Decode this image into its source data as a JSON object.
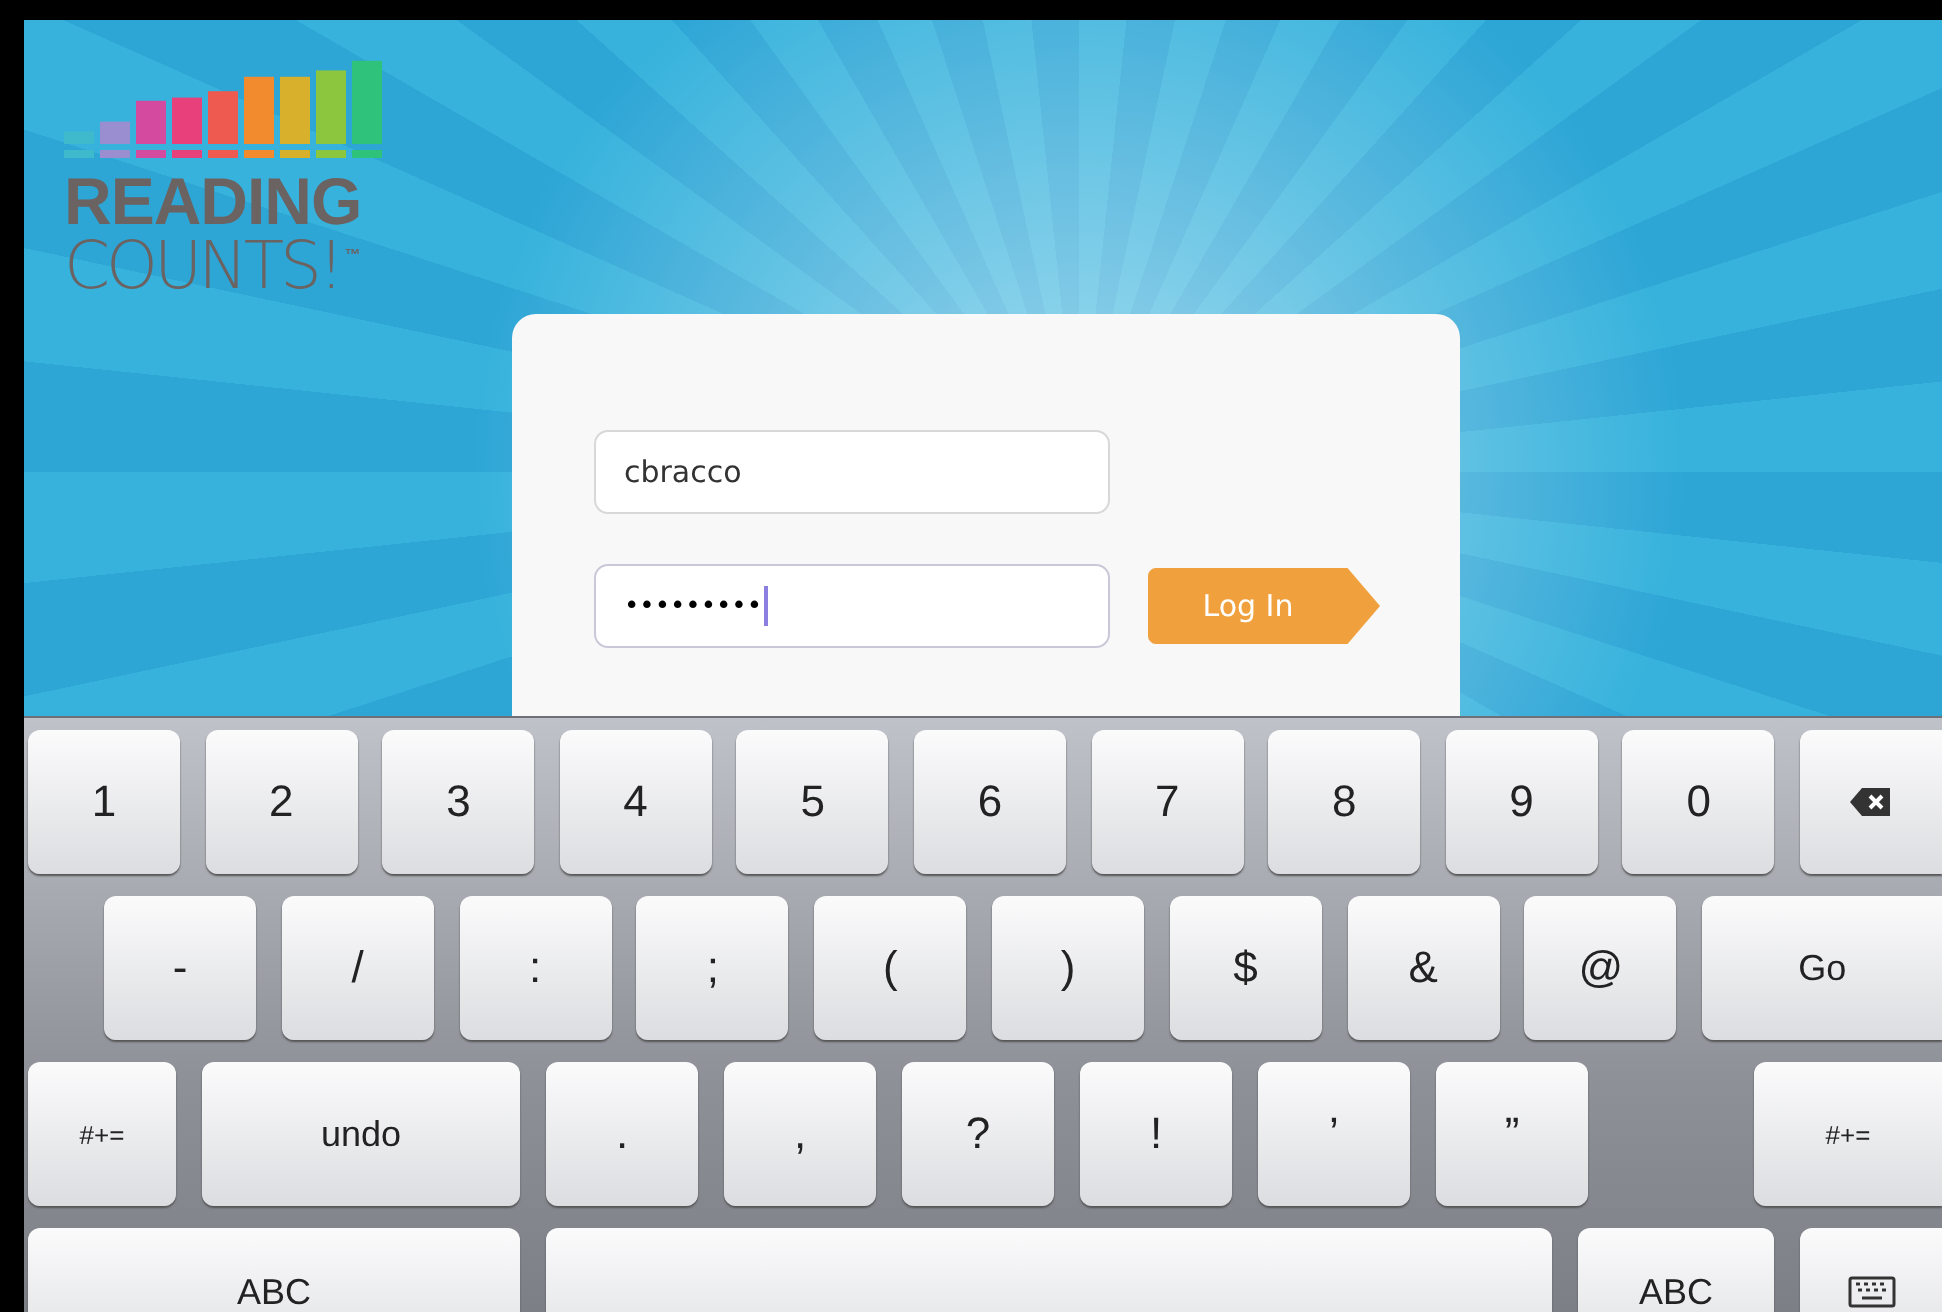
{
  "logo": {
    "line1": "READING",
    "line2": "COUNTS!",
    "mark": "™"
  },
  "login": {
    "fields": [
      {
        "kind": "username",
        "value": "cbracco",
        "focused": false
      },
      {
        "kind": "password",
        "value": "•••••••••",
        "focused": true
      }
    ],
    "button": "Log In"
  },
  "keyboard": {
    "rows": [
      {
        "keys": [
          {
            "kind": "char",
            "label": "1"
          },
          {
            "kind": "char",
            "label": "2"
          },
          {
            "kind": "char",
            "label": "3"
          },
          {
            "kind": "char",
            "label": "4"
          },
          {
            "kind": "char",
            "label": "5"
          },
          {
            "kind": "char",
            "label": "6"
          },
          {
            "kind": "char",
            "label": "7"
          },
          {
            "kind": "char",
            "label": "8"
          },
          {
            "kind": "char",
            "label": "9"
          },
          {
            "kind": "char",
            "label": "0"
          },
          {
            "kind": "delete"
          }
        ]
      },
      {
        "keys": [
          {
            "kind": "char",
            "label": "-"
          },
          {
            "kind": "char",
            "label": "/"
          },
          {
            "kind": "char",
            "label": ":"
          },
          {
            "kind": "char",
            "label": ";"
          },
          {
            "kind": "char",
            "label": "("
          },
          {
            "kind": "char",
            "label": ")"
          },
          {
            "kind": "char",
            "label": "$"
          },
          {
            "kind": "char",
            "label": "&"
          },
          {
            "kind": "char",
            "label": "@"
          },
          {
            "kind": "go",
            "label": "Go"
          }
        ]
      },
      {
        "keys": [
          {
            "kind": "symbols",
            "label": "#+="
          },
          {
            "kind": "undo",
            "label": "undo"
          },
          {
            "kind": "char",
            "label": "."
          },
          {
            "kind": "char",
            "label": ","
          },
          {
            "kind": "char",
            "label": "?"
          },
          {
            "kind": "char",
            "label": "!"
          },
          {
            "kind": "char",
            "label": "’"
          },
          {
            "kind": "char",
            "label": "”"
          },
          {
            "kind": "symbols",
            "label": "#+="
          }
        ]
      },
      {
        "keys": [
          {
            "kind": "abc",
            "label": "ABC"
          },
          {
            "kind": "space"
          },
          {
            "kind": "abc",
            "label": "ABC"
          },
          {
            "kind": "hide"
          }
        ]
      }
    ]
  }
}
